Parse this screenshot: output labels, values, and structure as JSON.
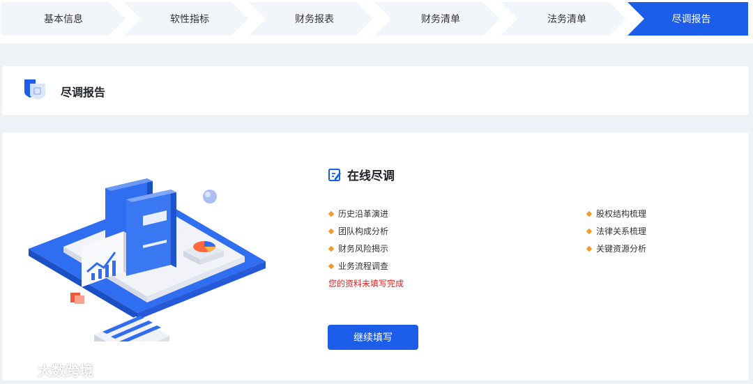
{
  "steps": [
    {
      "label": "基本信息",
      "active": false
    },
    {
      "label": "软性指标",
      "active": false
    },
    {
      "label": "财务报表",
      "active": false
    },
    {
      "label": "财务清单",
      "active": false
    },
    {
      "label": "法务清单",
      "active": false
    },
    {
      "label": "尽调报告",
      "active": true
    }
  ],
  "header": {
    "title": "尽调报告",
    "icon": "shield-report-icon"
  },
  "main": {
    "section_title": "在线尽调",
    "section_icon": "edit-document-icon",
    "items_left": [
      "历史沿革演进",
      "团队构成分析",
      "财务风险揭示",
      "业务流程调查"
    ],
    "items_right": [
      "股权结构梳理",
      "法律关系梳理",
      "关键资源分析"
    ],
    "warning": "您的资料未填写完成",
    "continue_label": "继续填写"
  },
  "watermark": {
    "text": "大数跨境"
  },
  "colors": {
    "accent": "#1c5ee9",
    "warning": "#e81d1d",
    "bullet": "#f39a2b",
    "step_bg": "#f2f5f9"
  }
}
